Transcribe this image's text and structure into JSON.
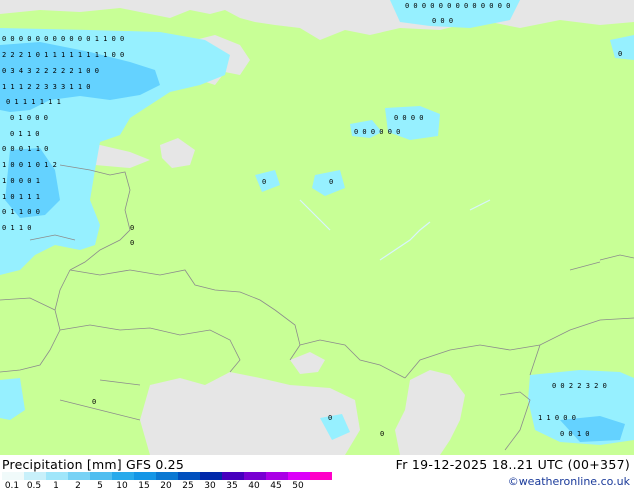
{
  "map": {
    "colors": {
      "land": "#c8ff96",
      "sea": "#e6e6e6",
      "light_precip": "#96f0ff",
      "medium_precip": "#64d2ff",
      "border": "#8c8c8c"
    },
    "grid_values": [
      {
        "row": "r1",
        "text": "0 0 0 0 0 0 0 0 0 0 0 1 1 0  0"
      },
      {
        "row": "r2",
        "text": "2 2 2 1 0 1 1 1 1 1 1 1 1 0  0"
      },
      {
        "row": "r3",
        "text": "0 3 4 3 2 2 2 2 2 1 0  0"
      },
      {
        "row": "r4",
        "text": "1 1 1 2 2 3 3 3 1 1 0"
      },
      {
        "row": "r5",
        "text": "0 1 1 1 1 1 1"
      },
      {
        "row": "r6",
        "text": "0 1 0 0  0"
      },
      {
        "row": "r7",
        "text": "0 1 1 0"
      },
      {
        "row": "r8",
        "text": "0 0 0 1 1 0"
      },
      {
        "row": "r9",
        "text": "1 0 0 1 0 1 2"
      },
      {
        "row": "r10",
        "text": "1 0 0 0 1"
      },
      {
        "row": "r11",
        "text": "1 0 1 1 1"
      },
      {
        "row": "r12",
        "text": "0 1 1 0  0"
      },
      {
        "row": "r13",
        "text": "0 1 1  0"
      },
      {
        "row": "ne1",
        "text": "0 0 0 0 0 0 0 0 0 0 0 0 0"
      },
      {
        "row": "ne2",
        "text": "0 0 0"
      },
      {
        "row": "c1",
        "text": "0 0 0 0"
      },
      {
        "row": "c2",
        "text": "0 0 0 0 0 0"
      },
      {
        "row": "se1",
        "text": "0 0 2 2 3 2 0"
      },
      {
        "row": "se2",
        "text": "1 1 0 0 0"
      },
      {
        "row": "se3",
        "text": "0 0 1 0"
      }
    ],
    "single_values": [
      "0",
      "0",
      "0",
      "0",
      "0",
      "0",
      "0",
      "0"
    ]
  },
  "footer": {
    "title": "Precipitation [mm]  GFS 0.25",
    "datetime": "Fr 19-12-2025 18..21 UTC (00+357)",
    "credit": "©weatheronline.co.uk",
    "legend_colors": [
      "#f0fafa",
      "#c8f0fa",
      "#a0e6fa",
      "#78d2f5",
      "#50bef0",
      "#28aaeb",
      "#1496e6",
      "#0a78d2",
      "#0050be",
      "#0028aa",
      "#4600be",
      "#7800d2",
      "#aa00e6",
      "#dc00fa",
      "#ff00c8"
    ],
    "legend_labels": [
      "0.1",
      "0.5",
      "1",
      "2",
      "5",
      "10",
      "15",
      "20",
      "25",
      "30",
      "35",
      "40",
      "45",
      "50"
    ]
  }
}
